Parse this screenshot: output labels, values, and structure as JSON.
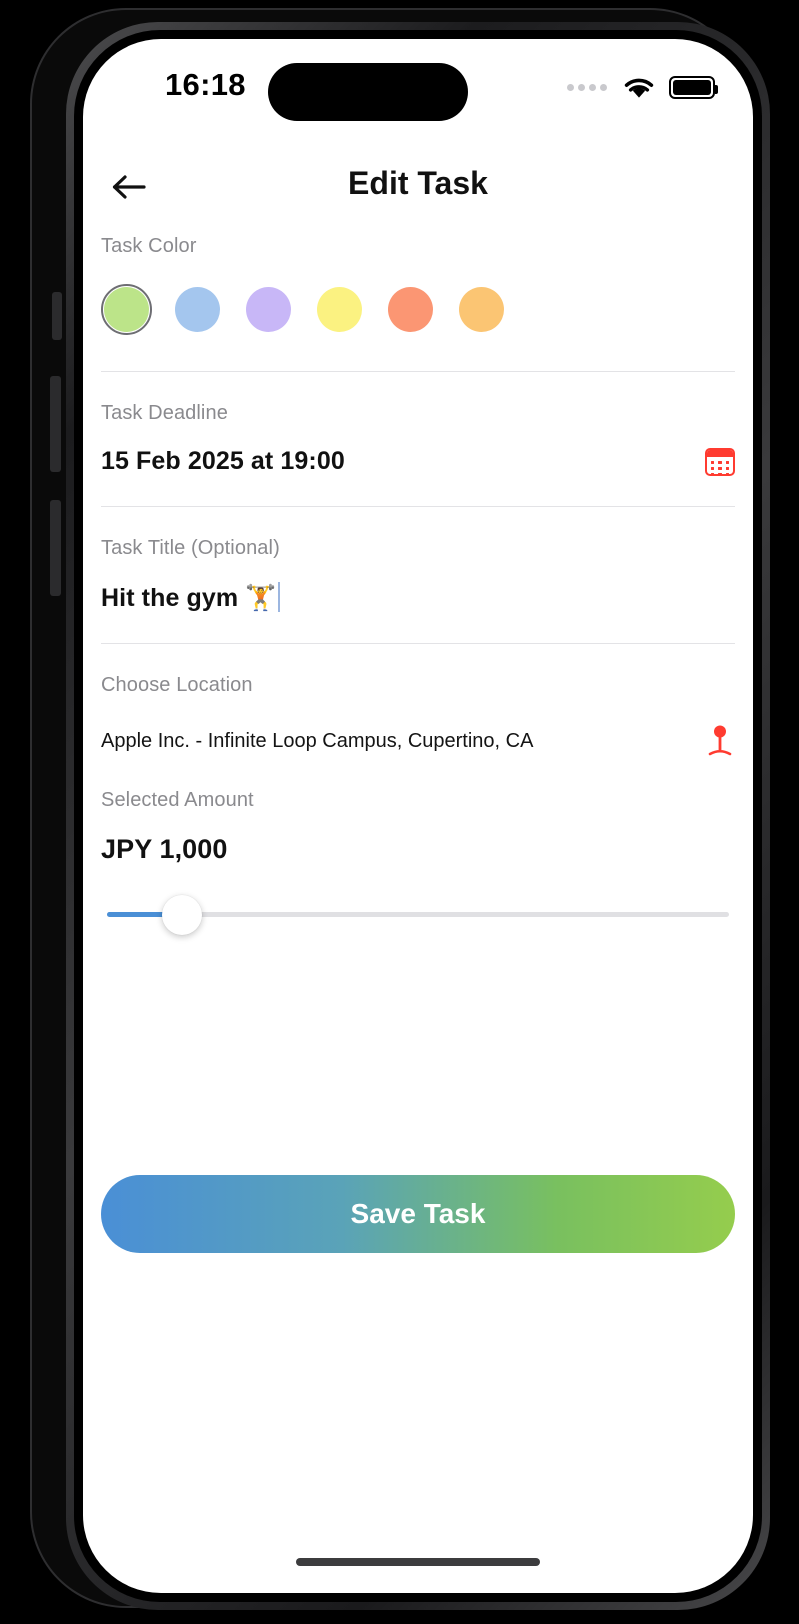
{
  "status_bar": {
    "time": "16:18",
    "cellular_icon": "signal-dots-icon",
    "wifi_icon": "wifi-icon",
    "battery_icon": "battery-full-icon"
  },
  "nav": {
    "back_icon": "arrow-left-icon",
    "title": "Edit Task"
  },
  "task_color": {
    "label": "Task Color",
    "selected_index": 0,
    "swatches": [
      {
        "name": "green",
        "hex": "#BCE489"
      },
      {
        "name": "blue",
        "hex": "#A4C6EE"
      },
      {
        "name": "purple",
        "hex": "#C8B7F7"
      },
      {
        "name": "yellow",
        "hex": "#FBF281"
      },
      {
        "name": "salmon",
        "hex": "#FB9673"
      },
      {
        "name": "orange",
        "hex": "#FBC573"
      }
    ]
  },
  "task_deadline": {
    "label": "Task Deadline",
    "value": "15 Feb 2025 at 19:00",
    "icon": "calendar-icon",
    "icon_color": "#FF3B30"
  },
  "task_title": {
    "label": "Task Title (Optional)",
    "value": "Hit the gym 🏋️",
    "placeholder": "Task Title (Optional)"
  },
  "location": {
    "label": "Choose Location",
    "value": "Apple Inc. - Infinite Loop Campus, Cupertino, CA",
    "icon": "map-pin-icon",
    "icon_color": "#FF3B30"
  },
  "amount": {
    "label": "Selected Amount",
    "value": "JPY 1,000",
    "currency": "JPY",
    "number": "1,000",
    "slider_percent": 12,
    "slider_fill_color": "#4A8FD6"
  },
  "save_button": {
    "label": "Save Task",
    "gradient_start": "#4A8FD6",
    "gradient_end": "#95CD4D"
  },
  "home_indicator": "home-indicator"
}
